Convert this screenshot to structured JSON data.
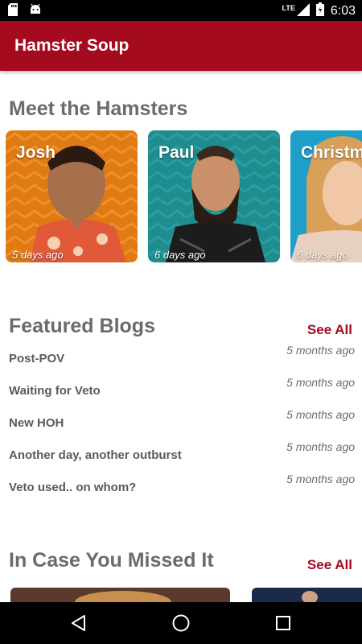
{
  "status_bar": {
    "time": "6:03",
    "network": "LTE",
    "left_icons": [
      "sd-card-icon",
      "android-icon"
    ],
    "right_icons": [
      "signal-icon",
      "battery-icon"
    ]
  },
  "app_bar": {
    "title": "Hamster Soup",
    "color": "#a50b1f"
  },
  "hamsters": {
    "heading": "Meet the Hamsters",
    "cards": [
      {
        "name": "Josh",
        "age": "5 days ago",
        "bg": "#e07a12"
      },
      {
        "name": "Paul",
        "age": "6 days ago",
        "bg": "#1f8d90"
      },
      {
        "name": "Christm",
        "age": "6 days ago",
        "bg": "#1fa0c8"
      }
    ]
  },
  "blogs": {
    "heading": "Featured Blogs",
    "see_all": "See All",
    "items": [
      {
        "title": "Post-POV",
        "time": "5 months ago"
      },
      {
        "title": "Waiting for Veto",
        "time": "5 months ago"
      },
      {
        "title": "New HOH",
        "time": "5 months ago"
      },
      {
        "title": "Another day, another outburst",
        "time": "5 months ago"
      },
      {
        "title": "Veto used.. on whom?",
        "time": "5 months ago"
      }
    ]
  },
  "missed": {
    "heading": "In Case You Missed It",
    "see_all": "See All"
  },
  "nav_bar": {
    "buttons": [
      "back-icon",
      "home-icon",
      "recents-icon"
    ]
  }
}
